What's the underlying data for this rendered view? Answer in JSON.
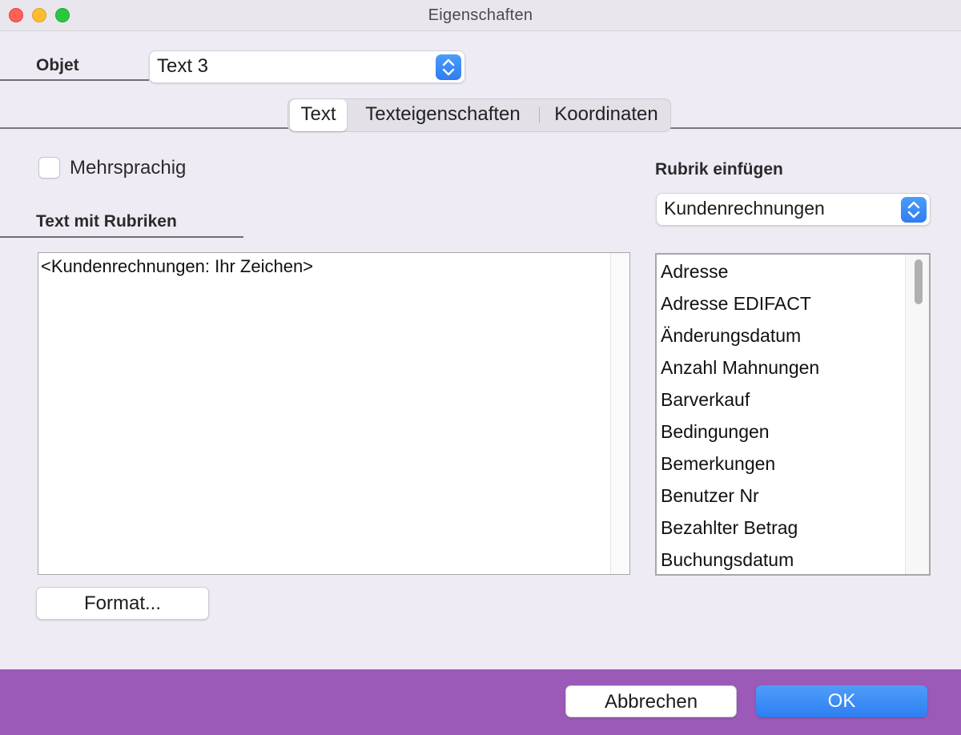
{
  "window": {
    "title": "Eigenschaften"
  },
  "objet": {
    "label": "Objet",
    "selected": "Text 3"
  },
  "tabs": [
    {
      "label": "Text"
    },
    {
      "label": "Texteigenschaften"
    },
    {
      "label": "Koordinaten"
    }
  ],
  "multilingual": {
    "label": "Mehrsprachig",
    "checked": false
  },
  "text_section": {
    "label": "Text mit Rubriken",
    "content": "<Kundenrechnungen: Ihr Zeichen>"
  },
  "format_button": "Format...",
  "insert_field": {
    "label": "Rubrik einfügen",
    "selected": "Kundenrechnungen",
    "items": [
      "Adresse",
      "Adresse EDIFACT",
      "Änderungsdatum",
      "Anzahl Mahnungen",
      "Barverkauf",
      "Bedingungen",
      "Bemerkungen",
      "Benutzer Nr",
      "Bezahlter Betrag",
      "Buchungsdatum"
    ]
  },
  "footer": {
    "cancel": "Abbrechen",
    "ok": "OK"
  },
  "colors": {
    "accent": "#2f7df0",
    "footer": "#9b5ab8",
    "background": "#efebf4"
  }
}
